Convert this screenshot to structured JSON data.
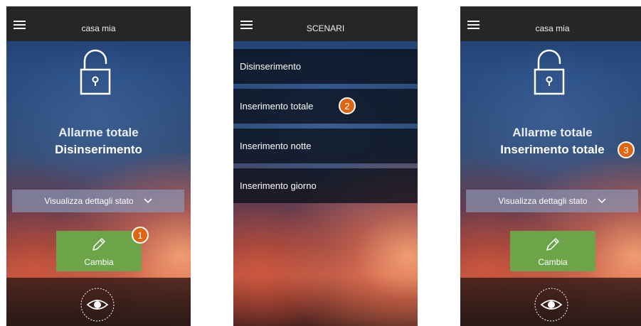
{
  "screens": [
    {
      "title": "casa mia",
      "status_title": "Allarme totale",
      "status_value": "Disinserimento",
      "details_label": "Visualizza dettagli stato",
      "change_label": "Cambia",
      "badge": "1"
    },
    {
      "title": "SCENARI",
      "items": [
        {
          "label": "Disinserimento"
        },
        {
          "label": "Inserimento totale"
        },
        {
          "label": "Inserimento notte"
        },
        {
          "label": "Inserimento giorno"
        }
      ],
      "badge": "2"
    },
    {
      "title": "casa mia",
      "status_title": "Allarme totale",
      "status_value": "Inserimento totale",
      "details_label": "Visualizza dettagli stato",
      "change_label": "Cambia",
      "badge": "3"
    }
  ],
  "icons": [
    "hamburger-icon",
    "lock-open-icon",
    "chevron-down-icon",
    "pencil-icon",
    "eye-icon"
  ],
  "colors": {
    "topbar": "#262626",
    "change_button": "#6da44a",
    "badge": "#e1650f",
    "details_bar": "#8c96b4"
  }
}
